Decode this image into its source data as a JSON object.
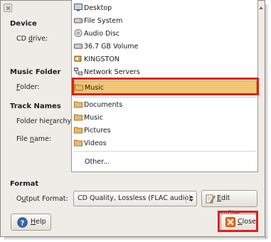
{
  "sections": {
    "device": {
      "title": "Device",
      "cd_drive_label_pre": "CD ",
      "cd_drive_label_u": "d",
      "cd_drive_label_post": "rive:"
    },
    "music_folder": {
      "title": "Music Folder",
      "folder_label_u": "F",
      "folder_label_post": "older:"
    },
    "track_names": {
      "title": "Track Names",
      "hierarchy_label_pre": "Folder hie",
      "hierarchy_label_u": "r",
      "hierarchy_label_post": "archy:",
      "filename_label_pre": "File ",
      "filename_label_u": "n",
      "filename_label_post": "ame:"
    },
    "format": {
      "title": "Format",
      "output_label_pre": "O",
      "output_label_u": "u",
      "output_label_post": "tput Format:",
      "output_value": "CD Quality, Lossless (FLAC audio)",
      "edit_profiles_pre": "",
      "edit_profiles_u": "E",
      "edit_profiles_post": "dit Profiles..."
    }
  },
  "folder_menu": {
    "places": [
      "Desktop",
      "File System",
      "Audio Disc",
      "36.7 GB Volume",
      "KINGSTON",
      "Network Servers"
    ],
    "selected": "Music",
    "bookmarks": [
      "Documents",
      "Music",
      "Pictures",
      "Videos"
    ],
    "other": "Other..."
  },
  "buttons": {
    "help_u": "H",
    "help_post": "elp",
    "close_u": "C",
    "close_post": "lose"
  },
  "colors": {
    "highlight": "#f2c677",
    "callout_red": "#d8231d",
    "help_blue": "#3465a4",
    "close_orange": "#e8742a"
  }
}
